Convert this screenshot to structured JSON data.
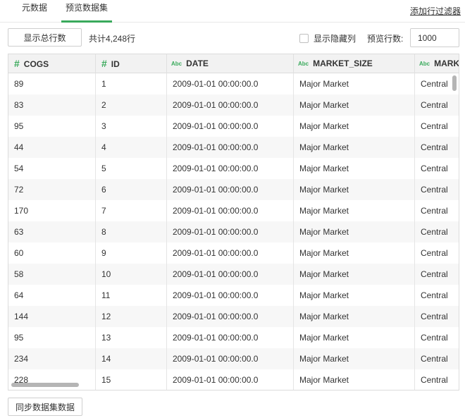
{
  "tabs": [
    {
      "label": "元数据"
    },
    {
      "label": "预览数据集",
      "active": true
    }
  ],
  "add_filter_label": "添加行过滤器",
  "toolbar": {
    "show_total_label": "显示总行数",
    "total_text": "共计4,248行",
    "show_hidden_label": "显示隐藏列",
    "show_hidden_checked": false,
    "preview_rows_label": "预览行数:",
    "preview_rows_value": "1000"
  },
  "accent_color": "#3aaa5c",
  "table": {
    "columns": [
      {
        "type_icon": "#",
        "type": "number",
        "name": "COGS"
      },
      {
        "type_icon": "#",
        "type": "number",
        "name": "ID"
      },
      {
        "type_icon": "Abc",
        "type": "text",
        "name": "DATE"
      },
      {
        "type_icon": "Abc",
        "type": "text",
        "name": "MARKET_SIZE"
      },
      {
        "type_icon": "Abc",
        "type": "text",
        "name": "MARKET"
      }
    ],
    "rows": [
      [
        "89",
        "1",
        "2009-01-01 00:00:00.0",
        "Major Market",
        "Central"
      ],
      [
        "83",
        "2",
        "2009-01-01 00:00:00.0",
        "Major Market",
        "Central"
      ],
      [
        "95",
        "3",
        "2009-01-01 00:00:00.0",
        "Major Market",
        "Central"
      ],
      [
        "44",
        "4",
        "2009-01-01 00:00:00.0",
        "Major Market",
        "Central"
      ],
      [
        "54",
        "5",
        "2009-01-01 00:00:00.0",
        "Major Market",
        "Central"
      ],
      [
        "72",
        "6",
        "2009-01-01 00:00:00.0",
        "Major Market",
        "Central"
      ],
      [
        "170",
        "7",
        "2009-01-01 00:00:00.0",
        "Major Market",
        "Central"
      ],
      [
        "63",
        "8",
        "2009-01-01 00:00:00.0",
        "Major Market",
        "Central"
      ],
      [
        "60",
        "9",
        "2009-01-01 00:00:00.0",
        "Major Market",
        "Central"
      ],
      [
        "58",
        "10",
        "2009-01-01 00:00:00.0",
        "Major Market",
        "Central"
      ],
      [
        "64",
        "11",
        "2009-01-01 00:00:00.0",
        "Major Market",
        "Central"
      ],
      [
        "144",
        "12",
        "2009-01-01 00:00:00.0",
        "Major Market",
        "Central"
      ],
      [
        "95",
        "13",
        "2009-01-01 00:00:00.0",
        "Major Market",
        "Central"
      ],
      [
        "234",
        "14",
        "2009-01-01 00:00:00.0",
        "Major Market",
        "Central"
      ],
      [
        "228",
        "15",
        "2009-01-01 00:00:00.0",
        "Major Market",
        "Central"
      ]
    ]
  },
  "sync_button_label": "同步数据集数据"
}
